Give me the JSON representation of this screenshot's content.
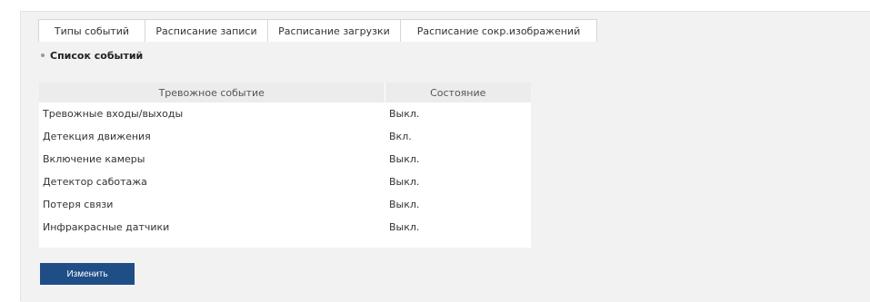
{
  "tabs": [
    {
      "label": "Типы событий"
    },
    {
      "label": "Расписание записи"
    },
    {
      "label": "Расписание загрузки"
    },
    {
      "label": "Расписание сокр.изображений"
    }
  ],
  "section": {
    "title": "Список событий"
  },
  "table": {
    "headers": [
      "Тревожное событие",
      "Состояние"
    ],
    "rows": [
      {
        "event": "Тревожные входы/выходы",
        "state": "Выкл."
      },
      {
        "event": "Детекция движения",
        "state": "Вкл."
      },
      {
        "event": "Включение камеры",
        "state": "Выкл."
      },
      {
        "event": "Детектор саботажа",
        "state": "Выкл."
      },
      {
        "event": "Потеря связи",
        "state": "Выкл."
      },
      {
        "event": "Инфракрасные датчики",
        "state": "Выкл."
      }
    ]
  },
  "actions": {
    "edit_label": "Изменить"
  },
  "colors": {
    "button_bg": "#1f4e86",
    "panel_bg": "#f2f2f2",
    "header_bg": "#ececec"
  }
}
